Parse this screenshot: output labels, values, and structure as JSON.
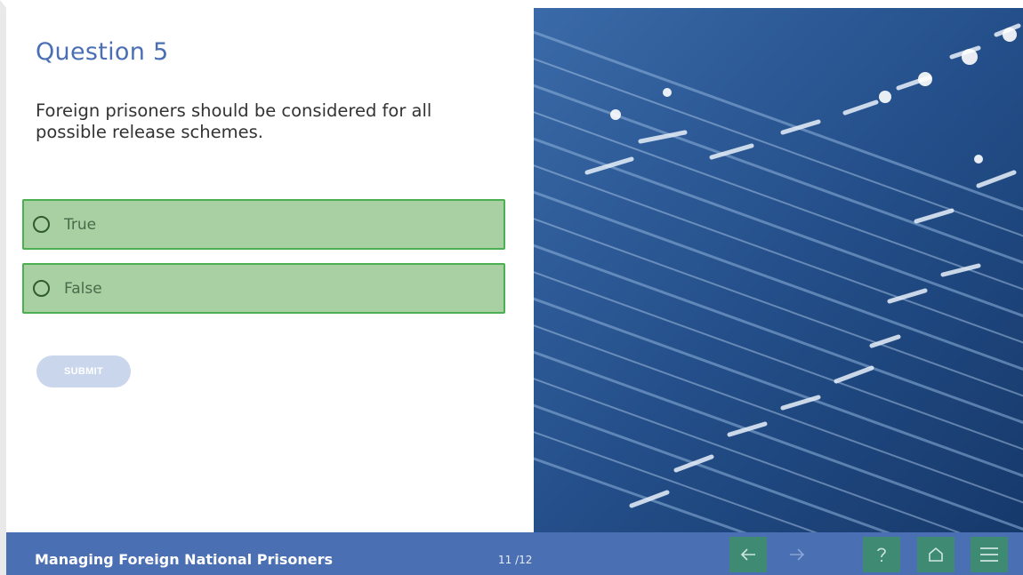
{
  "question": {
    "title": "Question 5",
    "text": "Foreign prisoners should be considered for all possible release schemes."
  },
  "options": [
    {
      "label": "True"
    },
    {
      "label": "False"
    }
  ],
  "submit": {
    "label": "SUBMIT"
  },
  "footer": {
    "course_title": "Managing Foreign National Prisoners",
    "page_counter": "11 /12"
  },
  "icons": {
    "prev": "arrow-left-icon",
    "next": "arrow-right-icon",
    "help": "question-mark-icon",
    "home": "home-icon",
    "menu": "hamburger-menu-icon"
  },
  "colors": {
    "accent": "#4a6fb3",
    "option_bg": "#a8d0a3",
    "option_border": "#4caf50",
    "nav_button": "#3f8a72",
    "submit_disabled": "#c9d6ec"
  }
}
